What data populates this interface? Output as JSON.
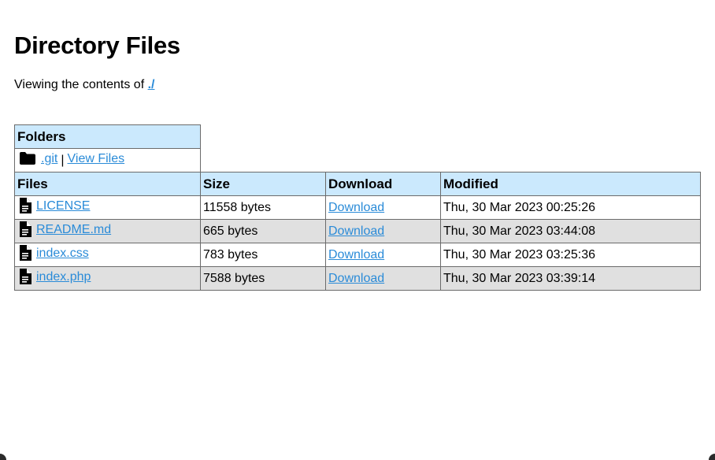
{
  "heading": "Directory Files",
  "subtitle": {
    "prefix": "Viewing the contents of ",
    "path": "./"
  },
  "folders": {
    "header": "Folders",
    "items": [
      {
        "name": ".git",
        "separator": "|",
        "view_label": "View Files",
        "icon": "folder-icon"
      }
    ]
  },
  "files": {
    "headers": {
      "name": "Files",
      "size": "Size",
      "download": "Download",
      "modified": "Modified"
    },
    "rows": [
      {
        "name": "LICENSE",
        "size": "11558 bytes",
        "download": "Download",
        "modified": "Thu, 30 Mar 2023 00:25:26",
        "icon": "file-icon"
      },
      {
        "name": "README.md",
        "size": "665 bytes",
        "download": "Download",
        "modified": "Thu, 30 Mar 2023 03:44:08",
        "icon": "file-icon"
      },
      {
        "name": "index.css",
        "size": "783 bytes",
        "download": "Download",
        "modified": "Thu, 30 Mar 2023 03:25:36",
        "icon": "file-icon"
      },
      {
        "name": "index.php",
        "size": "7588 bytes",
        "download": "Download",
        "modified": "Thu, 30 Mar 2023 03:39:14",
        "icon": "file-icon"
      }
    ]
  },
  "colors": {
    "header_bg": "#cbe9fd",
    "alt_row_bg": "#e0e0e0",
    "link": "#2a8bd8"
  }
}
